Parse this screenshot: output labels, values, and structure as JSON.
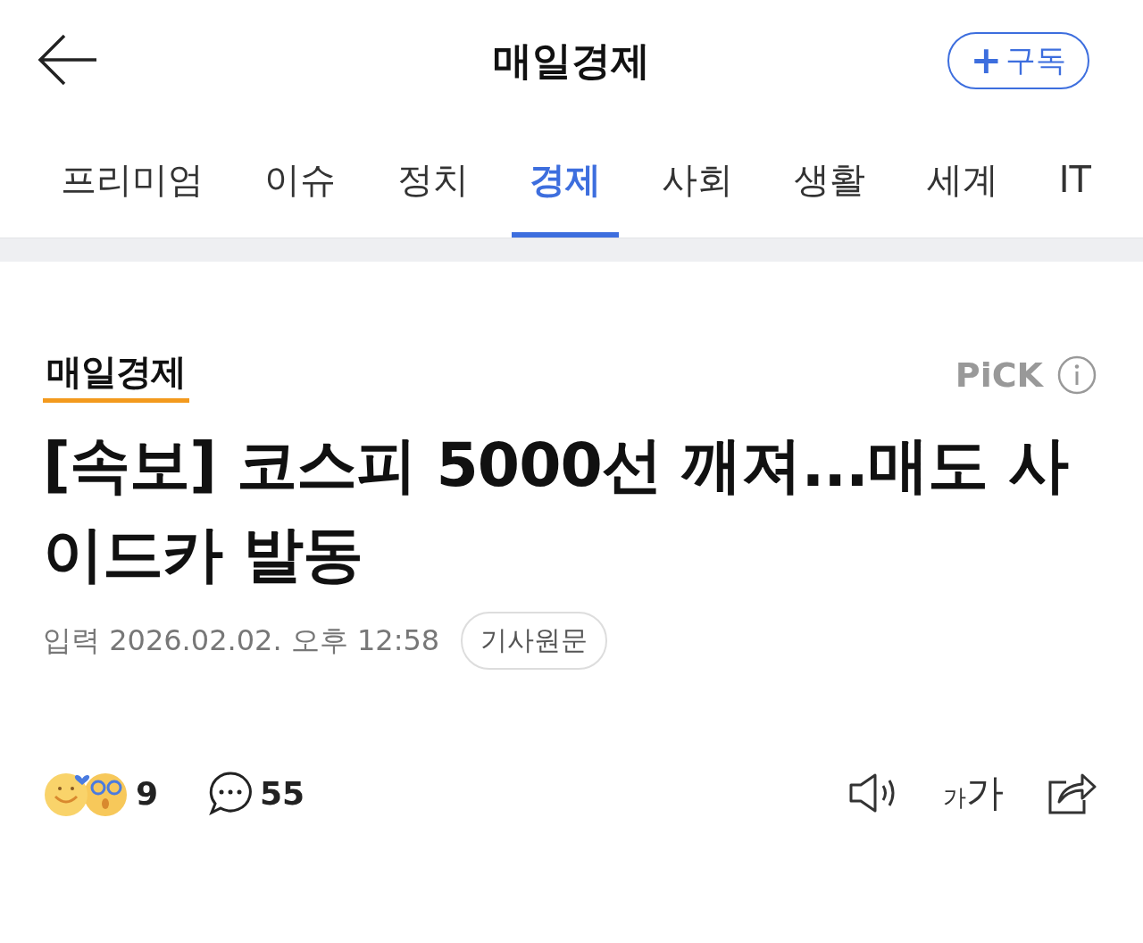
{
  "header": {
    "title": "매일경제",
    "subscribe": {
      "plus": "+",
      "label": "구독"
    }
  },
  "tabs": [
    {
      "label": "프리미엄",
      "selected": false
    },
    {
      "label": "이슈",
      "selected": false
    },
    {
      "label": "정치",
      "selected": false
    },
    {
      "label": "경제",
      "selected": true
    },
    {
      "label": "사회",
      "selected": false
    },
    {
      "label": "생활",
      "selected": false
    },
    {
      "label": "세계",
      "selected": false
    },
    {
      "label": "IT",
      "selected": false
    }
  ],
  "article": {
    "press": "매일경제",
    "pick": "PiCK",
    "headline": "[속보] 코스피 5000선 깨져...매도 사이드카 발동",
    "timestamp": "입력 2026.02.02. 오후 12:58",
    "original_link": "기사원문"
  },
  "actions": {
    "reactions": "9",
    "comments": "55",
    "font_size": {
      "small": "가",
      "large": "가"
    }
  }
}
